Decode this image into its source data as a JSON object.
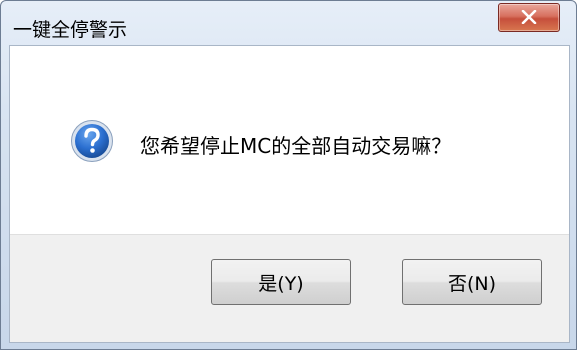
{
  "dialog": {
    "title": "一键全停警示",
    "message": "您希望停止MC的全部自动交易嘛？",
    "icon": "question-icon",
    "buttons": {
      "yes_label": "是(Y)",
      "no_label": "否(N)"
    },
    "close_icon": "close-icon",
    "colors": {
      "close_button": "#c64f3c",
      "icon_blue": "#1f5fb8"
    }
  }
}
